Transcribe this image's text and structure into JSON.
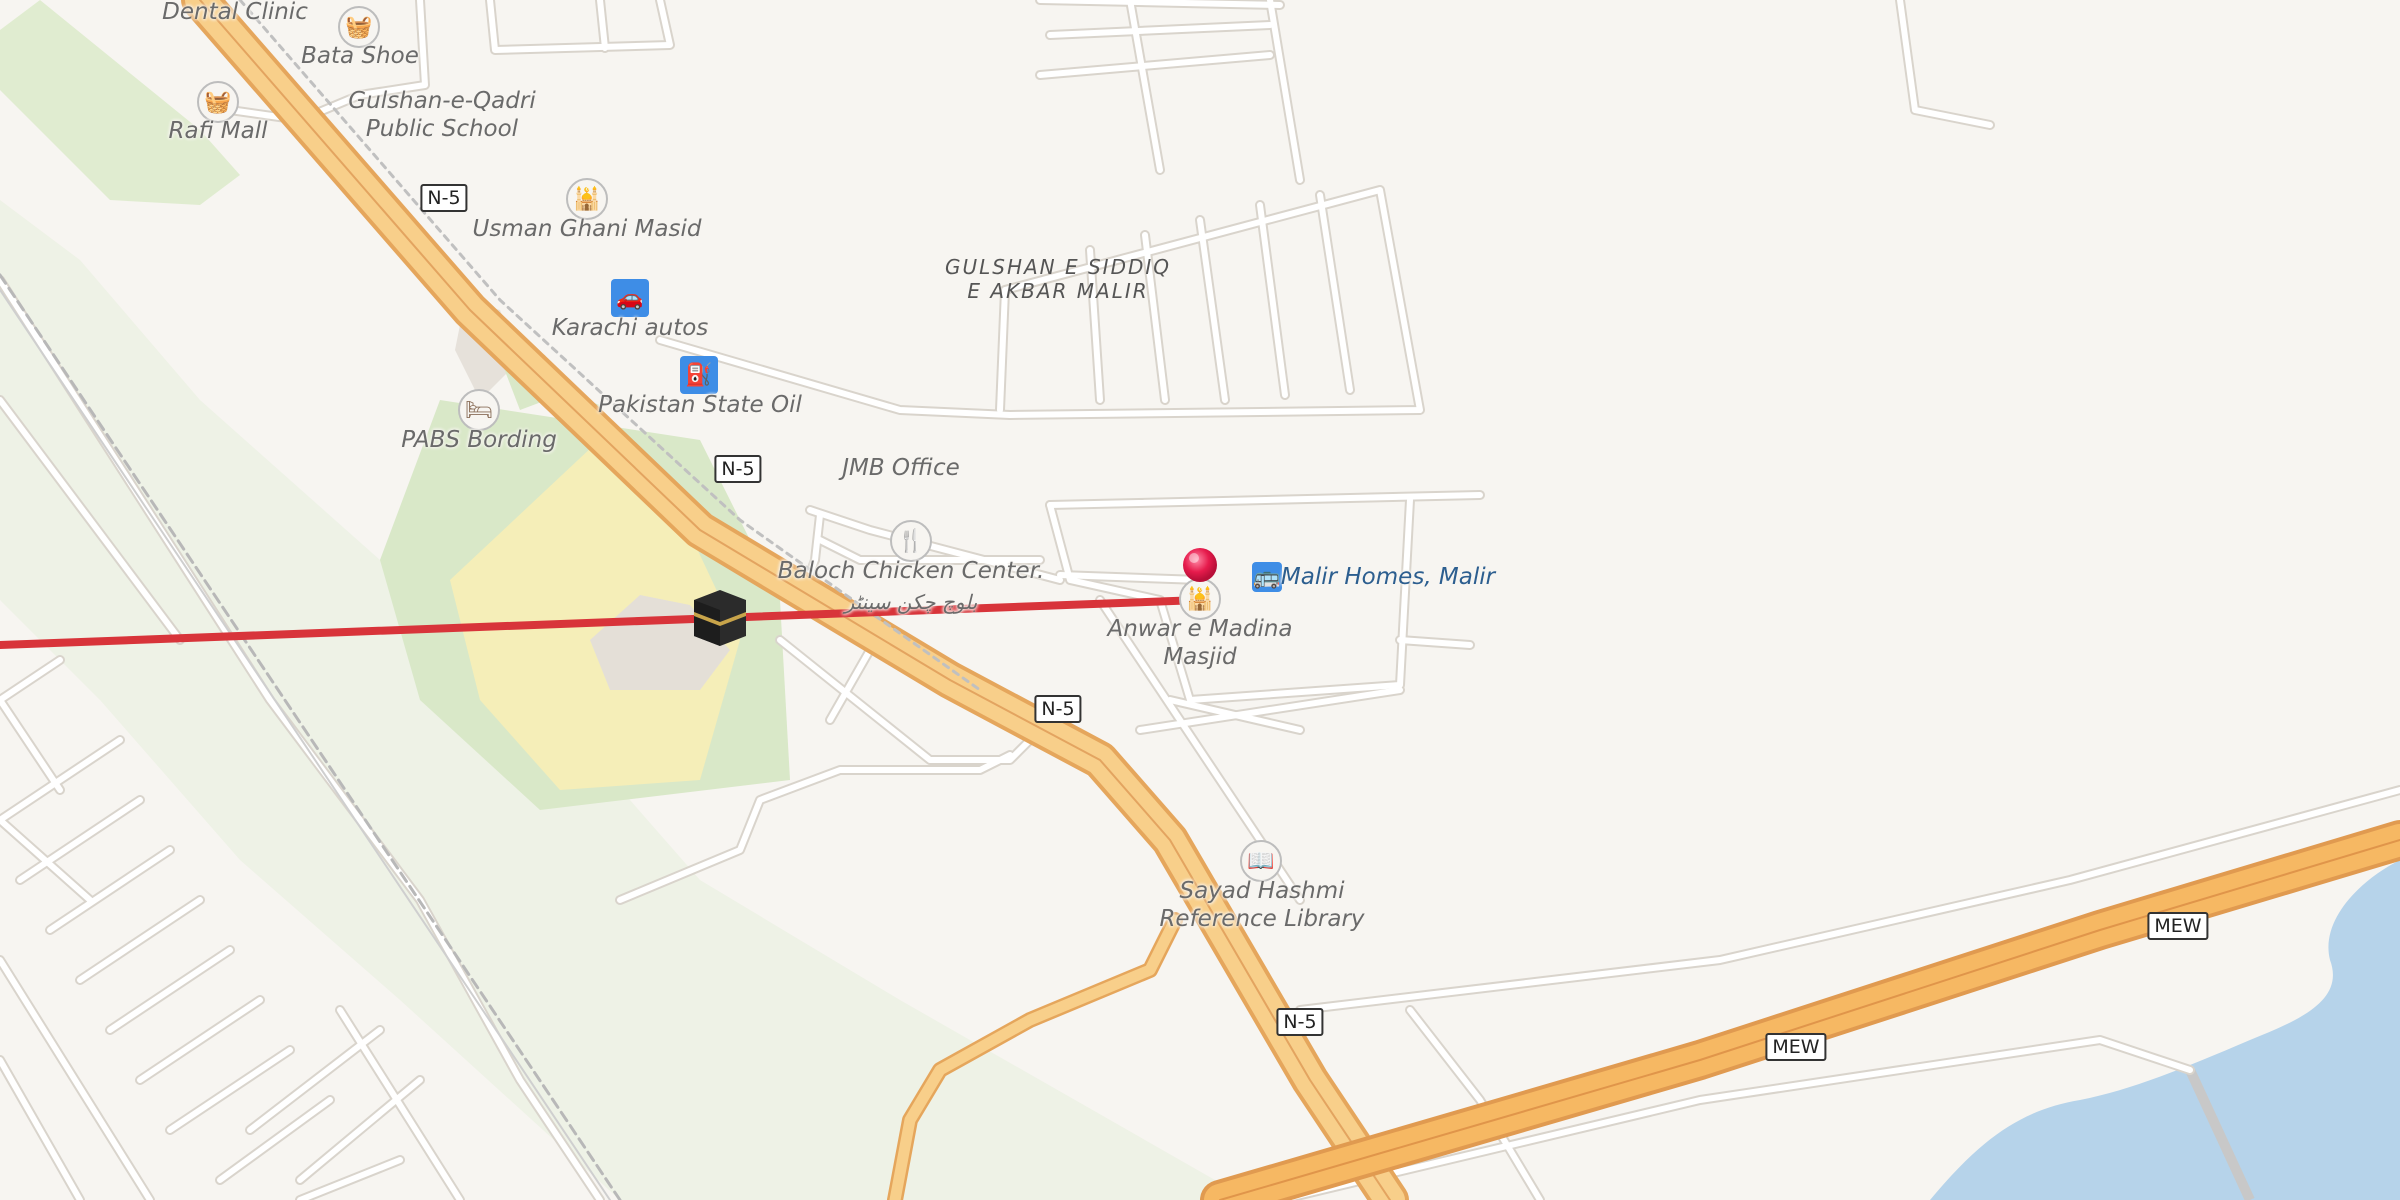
{
  "map": {
    "colors": {
      "background": "#f7f5f1",
      "road_minor": "#ffffff",
      "road_casing": "#d9d4cc",
      "highway_fill": "#f8cf8a",
      "highway_casing": "#e5a65c",
      "motorway_fill": "#f6b863",
      "park": "#e0ecd0",
      "school": "#f6eeb6",
      "water": "#b6d3ea",
      "route_line": "#d8343a"
    },
    "areas": {
      "gulshan_line1": "GULSHAN E SIDDIQ",
      "gulshan_line2": "E AKBAR MALIR"
    },
    "pois": {
      "dental_clinic": "Dental Clinic",
      "bata_shoe": "Bata Shoe",
      "rafi_mall": "Rafi Mall",
      "gulshan_school_line1": "Gulshan-e-Qadri",
      "gulshan_school_line2": "Public School",
      "usman_ghani": "Usman Ghani Masid",
      "karachi_autos": "Karachi autos",
      "pso": "Pakistan State Oil",
      "pabs": "PABS Bording",
      "jmb": "JMB Office",
      "baloch_chicken": "Baloch Chicken Center.",
      "baloch_chicken_urdu": "بلوچ چکن سینٹر",
      "anwar_line1": "Anwar e Madina",
      "anwar_line2": "Masjid",
      "malir_homes": "Malir Homes, Malir",
      "sayad_line1": "Sayad Hashmi",
      "sayad_line2": "Reference Library"
    },
    "shields": {
      "n5": "N-5",
      "mew": "MEW"
    },
    "icons": {
      "shop": "shopping-basket-icon",
      "mosque": "mosque-icon",
      "car": "car-icon",
      "fuel": "fuel-icon",
      "hotel": "bed-icon",
      "restaurant": "fork-knife-icon",
      "bus": "bus-stop-icon",
      "library": "book-icon",
      "kaaba": "kaaba-icon",
      "pin": "map-pin-icon"
    }
  }
}
